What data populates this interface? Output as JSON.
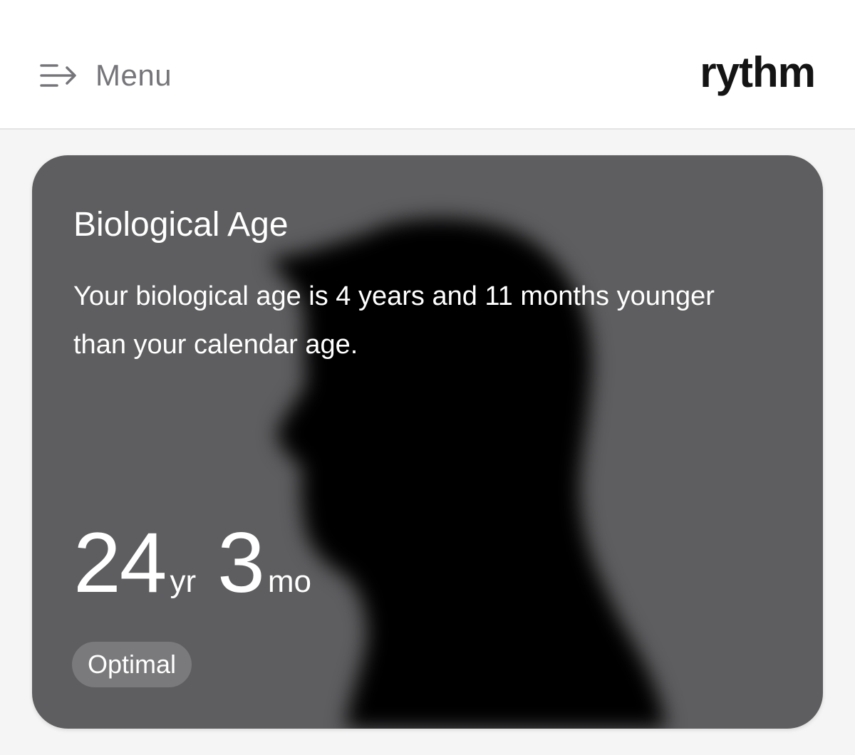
{
  "header": {
    "menu_icon": "menu-arrow-icon",
    "menu_label": "Menu",
    "brand": "rythm"
  },
  "card": {
    "title": "Biological Age",
    "description": "Your biological age is 4 years and 11 months younger than your calendar age.",
    "age_years": "24",
    "age_years_unit": "yr",
    "age_months": "3",
    "age_months_unit": "mo",
    "status": "Optimal",
    "background_color": "#5e5e60",
    "badge_color": "#7a7a7c"
  }
}
